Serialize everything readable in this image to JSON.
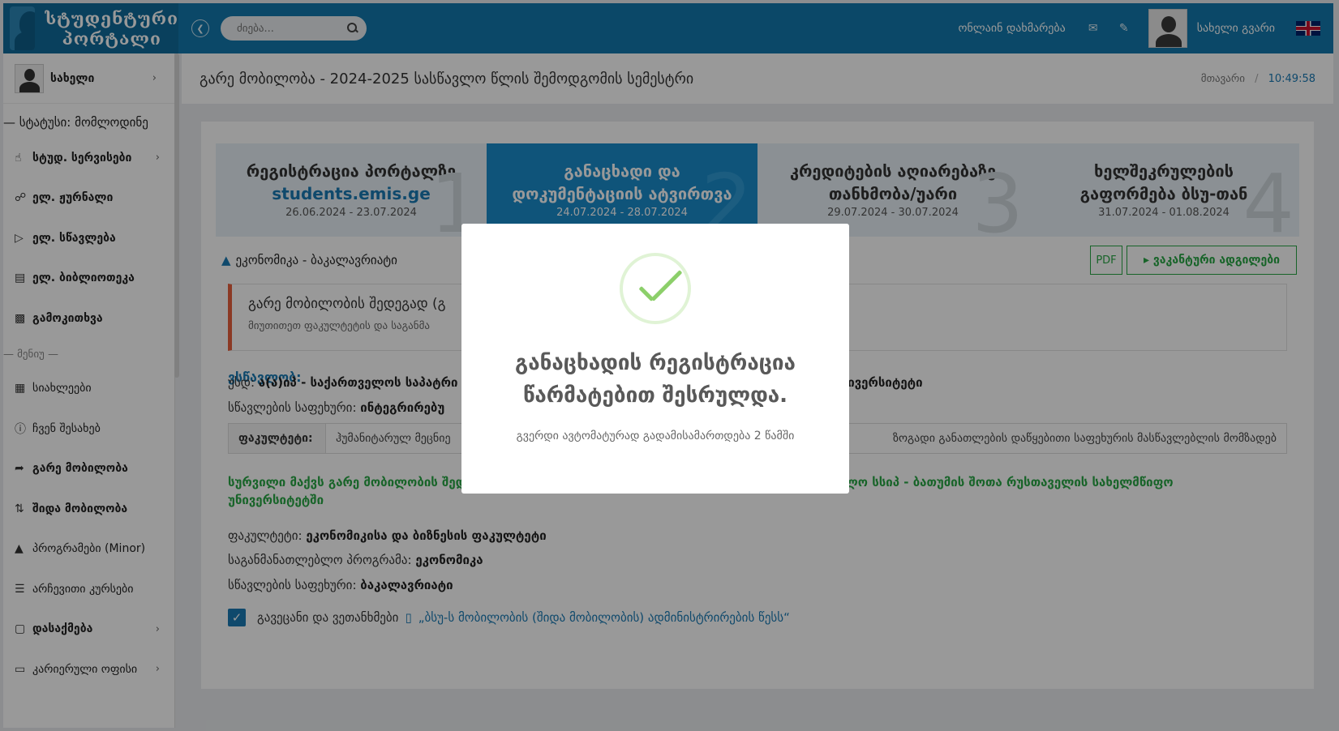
{
  "topbar": {
    "logo_line1": "სტუდენტური",
    "logo_line2": "პორტალი",
    "search_placeholder": "ძიება...",
    "help_link": "ონლაინ დახმარება",
    "user_name": "სახელი გვარი"
  },
  "sidebar": {
    "profile_name": "სახელი",
    "status": "— სტატუსი: მომლოდინე",
    "items_top": [
      {
        "label": "სტუდ. სერვისები",
        "icon": "thumb-icon"
      },
      {
        "label": "ელ. ჟურნალი",
        "icon": "link-icon"
      },
      {
        "label": "ელ. სწავლება",
        "icon": "megaphone-icon"
      },
      {
        "label": "ელ. ბიბლიოთეკა",
        "icon": "book-icon"
      },
      {
        "label": "გამოკითხვა",
        "icon": "chart-icon"
      }
    ],
    "section_menu": "— მენიუ —",
    "items_menu": [
      {
        "label": "სიახლეები",
        "icon": "clipboard-icon"
      },
      {
        "label": "ჩვენ შესახებ",
        "icon": "info-icon"
      },
      {
        "label": "გარე მობილობა",
        "icon": "share-icon"
      },
      {
        "label": "შიდა მობილობა",
        "icon": "shuffle-icon"
      },
      {
        "label": "პროგრამები (Minor)",
        "icon": "graduation-cap-icon"
      },
      {
        "label": "არჩევითი კურსები",
        "icon": "database-icon"
      },
      {
        "label": "დასაქმება",
        "icon": "briefcase-icon"
      },
      {
        "label": "კარიერული ოფისი",
        "icon": "laptop-icon"
      }
    ]
  },
  "header": {
    "title": "გარე მობილობა - 2024-2025 სასწავლო წლის შემოდგომის სემესტრი",
    "breadcrumb_home": "მთავარი",
    "breadcrumb_sep": "/",
    "time": "10:49:58"
  },
  "steps": [
    {
      "title_line1": "რეგისტრაცია პორტალზე",
      "title_link": "students.emis.ge",
      "date": "26.06.2024 - 23.07.2024",
      "num": "1"
    },
    {
      "title_line1": "განაცხადი და",
      "title_line2": "დოკუმენტაციის ატვირთვა",
      "date": "24.07.2024 - 28.07.2024",
      "num": "2"
    },
    {
      "title_line1": "კრედიტების აღიარებაზე",
      "title_line2": "თანხმობა/უარი",
      "date": "29.07.2024 - 30.07.2024",
      "num": "3"
    },
    {
      "title_line1": "ხელშეკრულების",
      "title_line2": "გაფორმება ბსუ-თან",
      "date": "31.07.2024 - 01.08.2024",
      "num": "4"
    }
  ],
  "content": {
    "faculty_program": "ეკონომიკა - ბაკალავრიატი",
    "pdf_label": "PDF",
    "vacant_button": "ვაკანტური ადგილები",
    "alert_title": "გარე მობილობის შედეგად (გ",
    "alert_text": "მიუთითეთ ფაკულტეტის და საგანმა",
    "study_head": "ვსწავლობ:",
    "uni_label": "უსდ:",
    "uni_value": "ა(ა)იპ - საქართველოს საპატრი",
    "uni_tail": "ული უნივერსიტეტი",
    "level_label": "სწავლების საფეხური:",
    "level_value": "ინტეგრირებუ",
    "faculty_th": "ფაკულტეტი:",
    "faculty_td": "ჰუმანიტარულ მეცნიე",
    "faculty_td_right": "ზოგადი განათლების დაწყებითი საფეხურის მასწავლებლის მომზადებ",
    "wish_text": "სურვილი მაქვს გარე მობილობის შედეგად (გადმოყვანის წესით) ჩავირიცხო და სწავლა გავაგრძელო სსიპ - ბათუმის შოთა რუსთაველის სახელმწიფო უნივერსიტეტში",
    "target_faculty_label": "ფაკულტეტი:",
    "target_faculty_value": "ეკონომიკისა და ბიზნესის ფაკულტეტი",
    "target_program_label": "საგანმანათლებლო პროგრამა:",
    "target_program_value": "ეკონომიკა",
    "target_level_label": "სწავლების საფეხური:",
    "target_level_value": "ბაკალავრიატი",
    "agree_text": "გავეცანი და ვეთანხმები",
    "agree_link": "„ბსუ-ს მობილობის (შიდა მობილობის) ადმინისტრირების წესს“"
  },
  "modal": {
    "title": "განაცხადის რეგისტრაცია წარმატებით შესრულდა.",
    "text": "გვერდი ავტომატურად გადამისამართდება 2 წამში"
  }
}
